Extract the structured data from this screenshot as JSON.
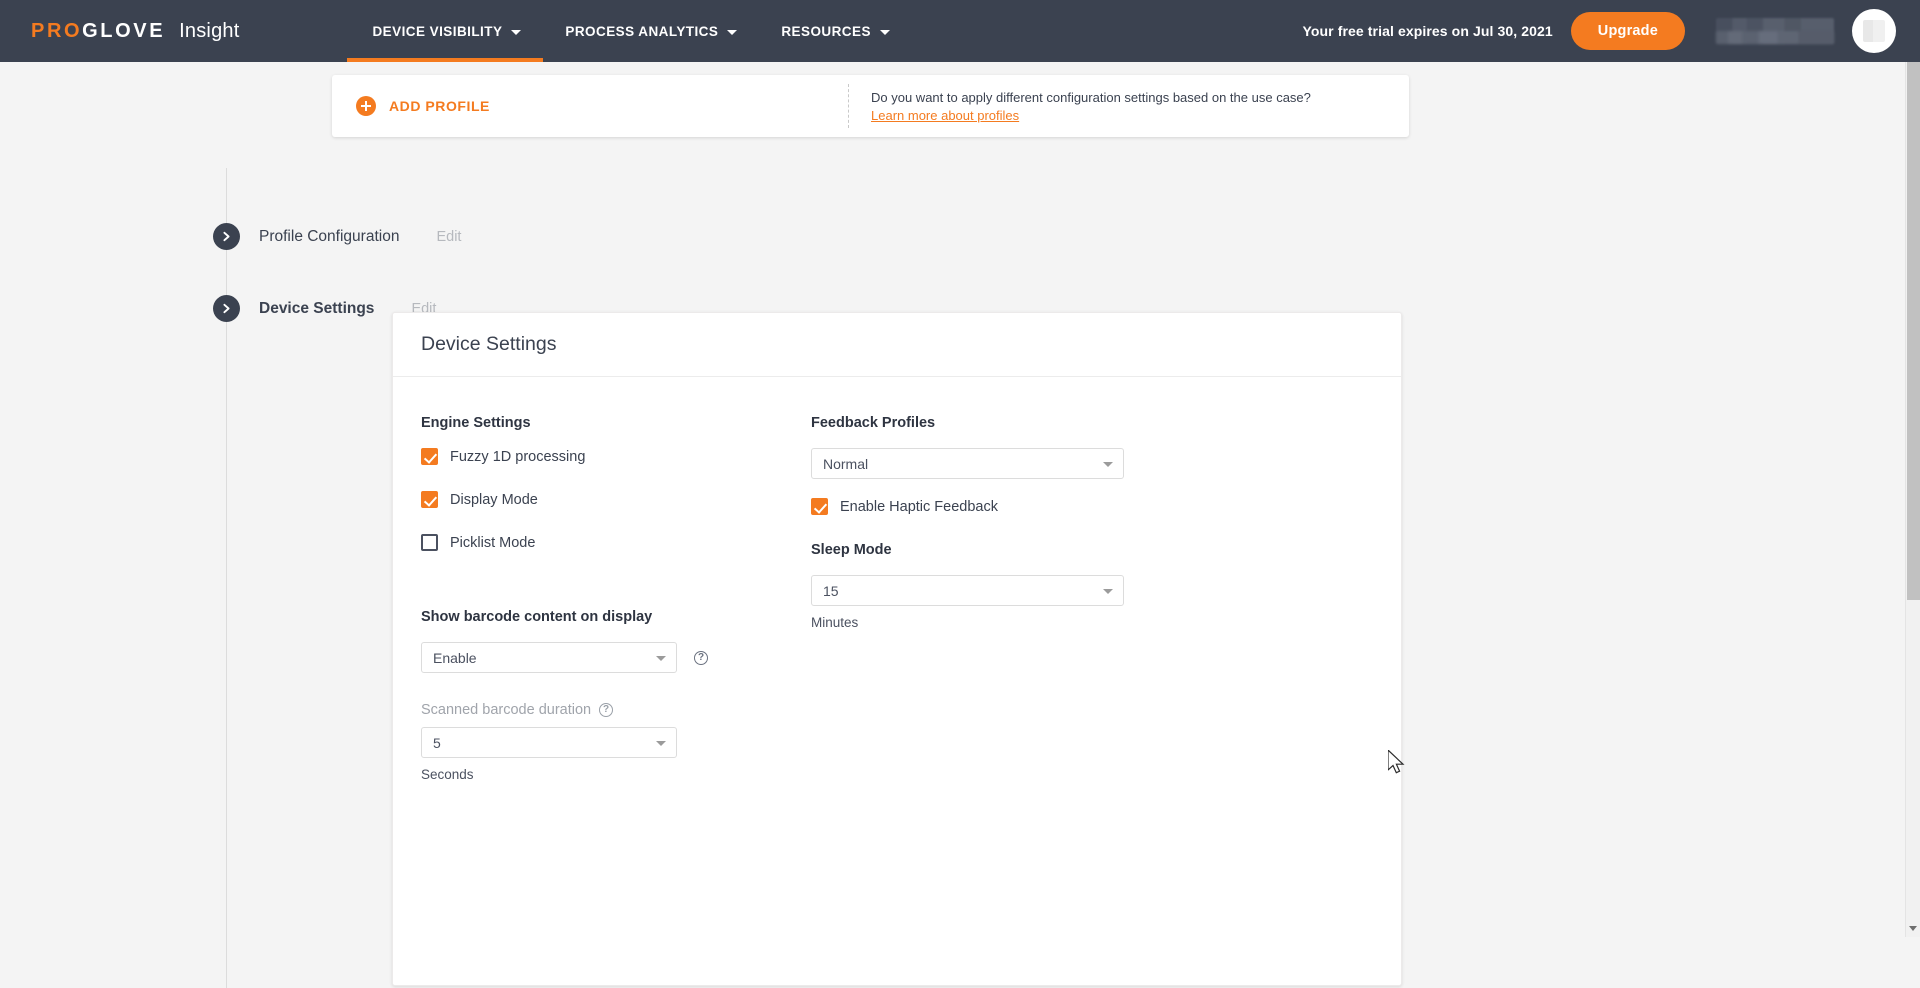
{
  "topbar": {
    "brand": {
      "pro": "PRO",
      "glove": "GLOVE",
      "product": "Insight"
    },
    "nav": [
      {
        "label": "DEVICE VISIBILITY",
        "icon": "chevron-down-icon",
        "active": true
      },
      {
        "label": "PROCESS ANALYTICS",
        "icon": "chevron-down-icon",
        "active": false
      },
      {
        "label": "RESOURCES",
        "icon": "chevron-down-icon",
        "active": false
      }
    ],
    "trial_text": "Your free trial expires on Jul 30, 2021",
    "upgrade_label": "Upgrade",
    "account_name_redacted": "",
    "avatar": "user-avatar"
  },
  "add_profile_card": {
    "button_label": "ADD PROFILE",
    "hint_question": "Do you want to apply different configuration settings based on the use case?",
    "hint_link": "Learn more about profiles"
  },
  "stepper": {
    "steps": [
      {
        "title": "Profile Configuration",
        "edit_label": "Edit",
        "active": false
      },
      {
        "title": "Device Settings",
        "edit_label": "Edit",
        "active": true
      }
    ]
  },
  "device_settings": {
    "card_title": "Device Settings",
    "engine": {
      "title": "Engine Settings",
      "checkboxes": [
        {
          "label": "Fuzzy 1D processing",
          "checked": true
        },
        {
          "label": "Display Mode",
          "checked": true
        },
        {
          "label": "Picklist Mode",
          "checked": false
        }
      ]
    },
    "feedback": {
      "title": "Feedback Profiles",
      "select_value": "Normal",
      "haptic": {
        "label": "Enable Haptic Feedback",
        "checked": true
      }
    },
    "sleep": {
      "title": "Sleep Mode",
      "select_value": "15",
      "unit": "Minutes"
    },
    "barcode": {
      "title": "Show barcode content on display",
      "select_value": "Enable",
      "help_icon": "help-circle-icon",
      "duration_label": "Scanned barcode duration",
      "duration_help_icon": "help-circle-icon",
      "duration_value": "5",
      "duration_unit": "Seconds"
    }
  },
  "colors": {
    "accent": "#f47b20",
    "header_bg": "#3b4250",
    "page_bg": "#f4f4f4",
    "card_bg": "#ffffff",
    "muted_text": "#a0a4ab"
  }
}
